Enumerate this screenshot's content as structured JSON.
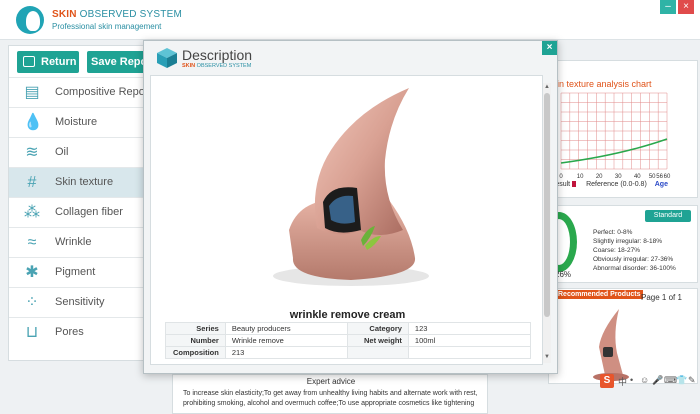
{
  "app": {
    "brand_prefix": "SKIN",
    "brand_rest": " OBSERVED SYSTEM",
    "subtitle": "Professional skin management",
    "min_label": "–",
    "close_label": "×"
  },
  "toolbar": {
    "return_label": "Return",
    "save_label": "Save Report"
  },
  "nav": {
    "items": [
      {
        "label": "Compositive Report",
        "icon": "document-icon",
        "glyph": "▤"
      },
      {
        "label": "Moisture",
        "icon": "water-drop-icon",
        "glyph": "💧"
      },
      {
        "label": "Oil",
        "icon": "oil-waves-icon",
        "glyph": "≋"
      },
      {
        "label": "Skin texture",
        "icon": "grid-hash-icon",
        "glyph": "#"
      },
      {
        "label": "Collagen fiber",
        "icon": "cells-icon",
        "glyph": "⁂"
      },
      {
        "label": "Wrinkle",
        "icon": "wave-lines-icon",
        "glyph": "≈"
      },
      {
        "label": "Pigment",
        "icon": "splat-icon",
        "glyph": "✱"
      },
      {
        "label": "Sensitivity",
        "icon": "dots-circle-icon",
        "glyph": "⁘"
      },
      {
        "label": "Pores",
        "icon": "pore-icon",
        "glyph": "⊔"
      }
    ],
    "active_index": 3
  },
  "texture_chart": {
    "title": "in texture analysis chart",
    "ticks": [
      "0",
      "10",
      "20",
      "30",
      "40",
      "50",
      "56",
      "60"
    ],
    "legend_result": "result",
    "legend_reference": "Reference",
    "reference_range": "(0.0-0.8)",
    "age_label": "Age"
  },
  "standard": {
    "badge": "Standard",
    "percent": "26%",
    "levels": [
      "Perfect: 0-8%",
      "Slightly irregular: 8-18%",
      "Coarse: 18-27%",
      "Obviously irregular: 27-36%",
      "Abnormal disorder: 36-100%"
    ]
  },
  "recommended": {
    "title": "Recommended Products",
    "page": "Page 1 of 1"
  },
  "advice": {
    "title": "Expert advice",
    "text": "To increase skin elasticity;To get away from unhealthy living habits and alternate work with rest, prohibiting smoking, alcohol and overmuch coffee;To use appropriate cosmetics like tightening"
  },
  "dialog": {
    "title": "Description",
    "brand_prefix": "SKIN",
    "brand_rest": " OBSERVED SYSTEM",
    "close_label": "×",
    "product_name": "wrinkle remove cream",
    "specs": {
      "series_label": "Series",
      "series_value": "Beauty producers",
      "category_label": "Category",
      "category_value": "123",
      "number_label": "Number",
      "number_value": "Wrinkle remove",
      "net_weight_label": "Net weight",
      "net_weight_value": "100ml",
      "composition_label": "Composition",
      "composition_value": "213"
    }
  },
  "colors": {
    "teal": "#1fa394",
    "orange": "#e0541a",
    "product_pink": "#d9a193"
  }
}
